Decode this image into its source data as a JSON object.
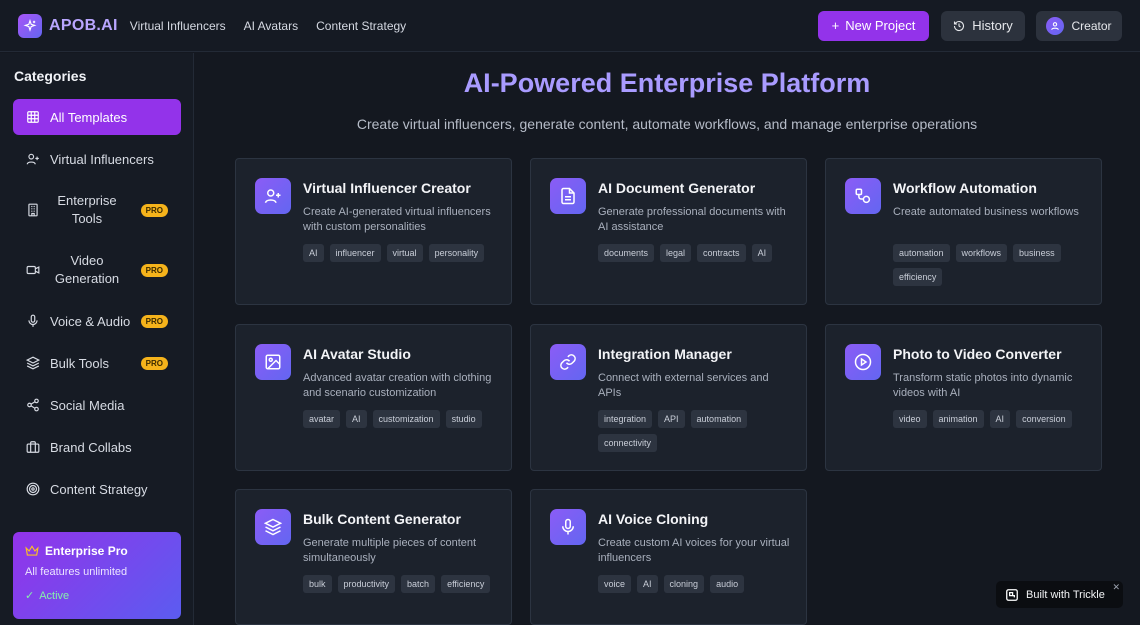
{
  "header": {
    "logo_text": "APOB.AI",
    "nav": [
      "Virtual Influencers",
      "AI Avatars",
      "Content Strategy"
    ],
    "new_project_label": "New Project",
    "history_label": "History",
    "user_label": "Creator"
  },
  "sidebar": {
    "title": "Categories",
    "items": [
      {
        "label": "All Templates",
        "icon": "grid-icon",
        "active": true
      },
      {
        "label": "Virtual Influencers",
        "icon": "user-plus-icon"
      },
      {
        "label": "Enterprise Tools",
        "icon": "building-icon",
        "badge": "PRO"
      },
      {
        "label": "Video Generation",
        "icon": "video-icon",
        "badge": "PRO"
      },
      {
        "label": "Voice & Audio",
        "icon": "microphone-icon",
        "badge": "PRO"
      },
      {
        "label": "Bulk Tools",
        "icon": "layers-icon",
        "badge": "PRO"
      },
      {
        "label": "Social Media",
        "icon": "share-icon"
      },
      {
        "label": "Brand Collabs",
        "icon": "briefcase-icon"
      },
      {
        "label": "Content Strategy",
        "icon": "target-icon"
      }
    ],
    "promo": {
      "title": "Enterprise Pro",
      "subtitle": "All features unlimited",
      "status": "Active"
    }
  },
  "main": {
    "title": "AI-Powered Enterprise Platform",
    "subtitle": "Create virtual influencers, generate content, automate workflows, and manage enterprise operations",
    "cards": [
      {
        "title": "Virtual Influencer Creator",
        "icon": "user-plus-icon",
        "description": "Create AI-generated virtual influencers with custom personalities",
        "tags": [
          "AI",
          "influencer",
          "virtual",
          "personality"
        ]
      },
      {
        "title": "AI Document Generator",
        "icon": "document-icon",
        "description": "Generate professional documents with AI assistance",
        "tags": [
          "documents",
          "legal",
          "contracts",
          "AI"
        ]
      },
      {
        "title": "Workflow Automation",
        "icon": "workflow-icon",
        "description": "Create automated business workflows",
        "tags": [
          "automation",
          "workflows",
          "business",
          "efficiency"
        ]
      },
      {
        "title": "AI Avatar Studio",
        "icon": "image-icon",
        "description": "Advanced avatar creation with clothing and scenario customization",
        "tags": [
          "avatar",
          "AI",
          "customization",
          "studio"
        ]
      },
      {
        "title": "Integration Manager",
        "icon": "link-icon",
        "description": "Connect with external services and APIs",
        "tags": [
          "integration",
          "API",
          "automation",
          "connectivity"
        ]
      },
      {
        "title": "Photo to Video Converter",
        "icon": "play-icon",
        "description": "Transform static photos into dynamic videos with AI",
        "tags": [
          "video",
          "animation",
          "AI",
          "conversion"
        ]
      },
      {
        "title": "Bulk Content Generator",
        "icon": "layers-icon",
        "description": "Generate multiple pieces of content simultaneously",
        "tags": [
          "bulk",
          "productivity",
          "batch",
          "efficiency"
        ]
      },
      {
        "title": "AI Voice Cloning",
        "icon": "microphone-icon",
        "description": "Create custom AI voices for your virtual influencers",
        "tags": [
          "voice",
          "AI",
          "cloning",
          "audio"
        ]
      }
    ]
  },
  "badge": {
    "label": "Built with Trickle"
  },
  "colors": {
    "accent": "#9333ea",
    "pro_badge": "#f5b31b",
    "title": "#a99bff"
  }
}
